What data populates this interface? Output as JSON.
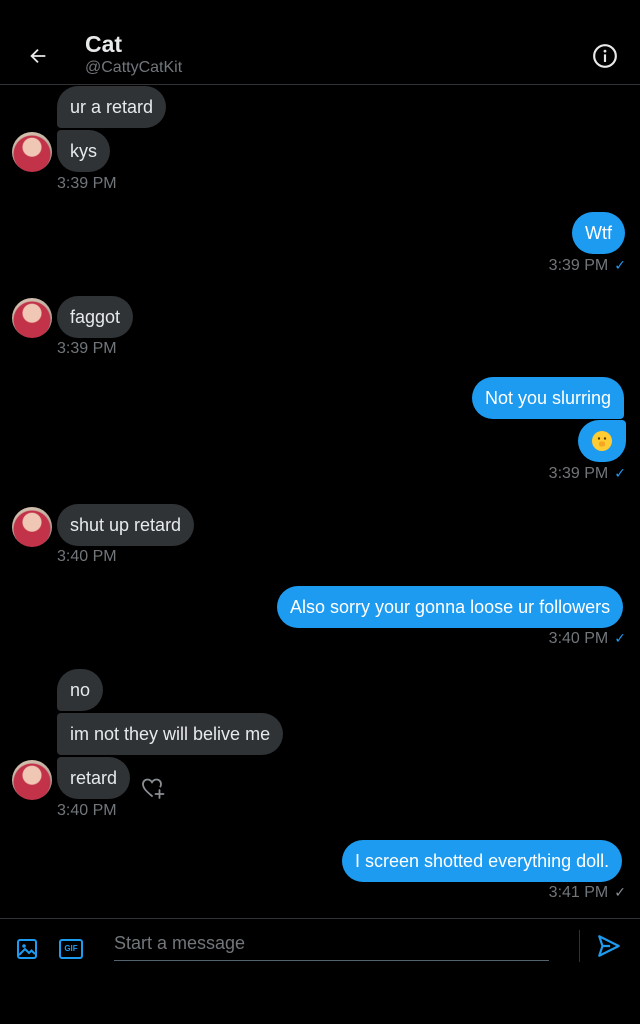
{
  "header": {
    "name": "Cat",
    "handle": "@CattyCatKit"
  },
  "messages": {
    "m1": "ur a retard",
    "m2": "kys",
    "t1": "3:39 PM",
    "m3": "Wtf",
    "t2": "3:39 PM",
    "m4": "faggot",
    "t3": "3:39 PM",
    "m5": "Not you slurring",
    "m6": "🫢",
    "t4": "3:39 PM",
    "m7": "shut up retard",
    "t5": "3:40 PM",
    "m8": "Also sorry your gonna loose ur followers",
    "t6": "3:40 PM",
    "m9": "no",
    "m10": "im not they will belive me",
    "m11": "retard",
    "t7": "3:40 PM",
    "m12": "I screen shotted everything doll.",
    "t8": "3:41 PM"
  },
  "status": {
    "delivered_mark": "✓"
  },
  "composer": {
    "placeholder": "Start a message",
    "gif_label": "GIF"
  },
  "colors": {
    "accent": "#1d9bf0",
    "background": "#000000",
    "incoming_bubble": "#2f3336",
    "muted_text": "#71767b"
  }
}
